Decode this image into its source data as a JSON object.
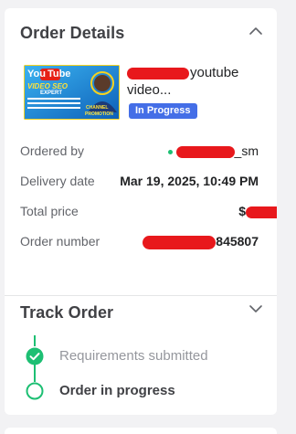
{
  "order_details": {
    "title": "Order Details",
    "gig": {
      "title_visible": "youtube",
      "title_line2": "video...",
      "thumbnail_text": {
        "logo_you": "You",
        "logo_tube": "Tube",
        "line1": "VIDEO SEO",
        "line2": "EXPERT",
        "channel": "CHANNEL",
        "channel2": "PROMOTION"
      }
    },
    "status_badge": "In Progress",
    "rows": {
      "ordered_by": {
        "label": "Ordered by",
        "value": "_sm"
      },
      "delivery_date": {
        "label": "Delivery date",
        "value": "Mar 19, 2025, 10:49 PM"
      },
      "total_price": {
        "label": "Total price",
        "value": "$"
      },
      "order_number": {
        "label": "Order number",
        "value": "845807"
      }
    }
  },
  "track_order": {
    "title": "Track Order",
    "steps": [
      {
        "label": "Requirements submitted",
        "state": "done"
      },
      {
        "label": "Order in progress",
        "state": "current"
      }
    ]
  },
  "colors": {
    "accent_green": "#1dbf73",
    "badge_blue": "#446ee7",
    "redaction_red": "#e8181c"
  },
  "icons": {
    "section_collapse": "chevron-up-icon",
    "section_expand": "chevron-down-icon",
    "step_done": "check-circle-icon",
    "step_current": "empty-circle-icon"
  }
}
